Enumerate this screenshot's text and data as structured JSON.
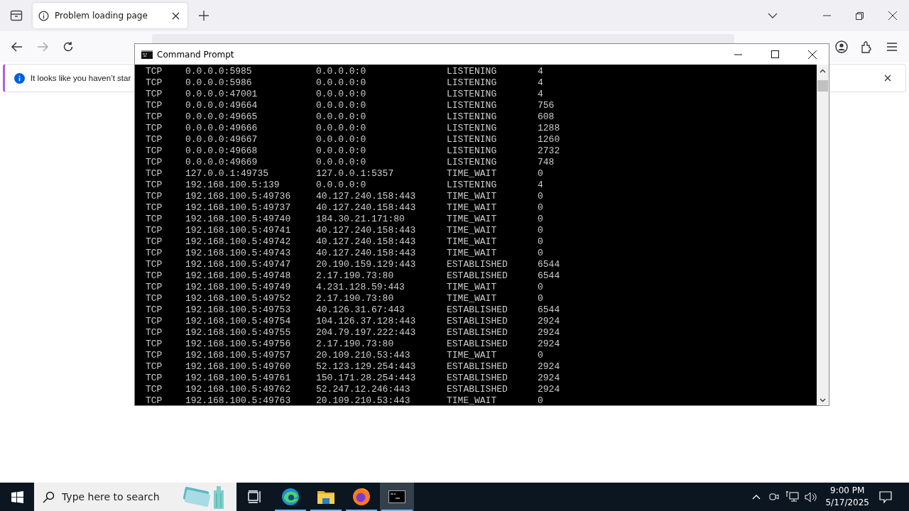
{
  "browser": {
    "tab": {
      "title": "Problem loading page"
    },
    "notification": {
      "text": "It looks like you haven’t star"
    }
  },
  "console": {
    "title": "Command Prompt",
    "rows": [
      [
        "TCP",
        "0.0.0.0:5985",
        "0.0.0.0:0",
        "LISTENING",
        "4"
      ],
      [
        "TCP",
        "0.0.0.0:5986",
        "0.0.0.0:0",
        "LISTENING",
        "4"
      ],
      [
        "TCP",
        "0.0.0.0:47001",
        "0.0.0.0:0",
        "LISTENING",
        "4"
      ],
      [
        "TCP",
        "0.0.0.0:49664",
        "0.0.0.0:0",
        "LISTENING",
        "756"
      ],
      [
        "TCP",
        "0.0.0.0:49665",
        "0.0.0.0:0",
        "LISTENING",
        "608"
      ],
      [
        "TCP",
        "0.0.0.0:49666",
        "0.0.0.0:0",
        "LISTENING",
        "1288"
      ],
      [
        "TCP",
        "0.0.0.0:49667",
        "0.0.0.0:0",
        "LISTENING",
        "1260"
      ],
      [
        "TCP",
        "0.0.0.0:49668",
        "0.0.0.0:0",
        "LISTENING",
        "2732"
      ],
      [
        "TCP",
        "0.0.0.0:49669",
        "0.0.0.0:0",
        "LISTENING",
        "748"
      ],
      [
        "TCP",
        "127.0.0.1:49735",
        "127.0.0.1:5357",
        "TIME_WAIT",
        "0"
      ],
      [
        "TCP",
        "192.168.100.5:139",
        "0.0.0.0:0",
        "LISTENING",
        "4"
      ],
      [
        "TCP",
        "192.168.100.5:49736",
        "40.127.240.158:443",
        "TIME_WAIT",
        "0"
      ],
      [
        "TCP",
        "192.168.100.5:49737",
        "40.127.240.158:443",
        "TIME_WAIT",
        "0"
      ],
      [
        "TCP",
        "192.168.100.5:49740",
        "184.30.21.171:80",
        "TIME_WAIT",
        "0"
      ],
      [
        "TCP",
        "192.168.100.5:49741",
        "40.127.240.158:443",
        "TIME_WAIT",
        "0"
      ],
      [
        "TCP",
        "192.168.100.5:49742",
        "40.127.240.158:443",
        "TIME_WAIT",
        "0"
      ],
      [
        "TCP",
        "192.168.100.5:49743",
        "40.127.240.158:443",
        "TIME_WAIT",
        "0"
      ],
      [
        "TCP",
        "192.168.100.5:49747",
        "20.190.159.129:443",
        "ESTABLISHED",
        "6544"
      ],
      [
        "TCP",
        "192.168.100.5:49748",
        "2.17.190.73:80",
        "ESTABLISHED",
        "6544"
      ],
      [
        "TCP",
        "192.168.100.5:49749",
        "4.231.128.59:443",
        "TIME_WAIT",
        "0"
      ],
      [
        "TCP",
        "192.168.100.5:49752",
        "2.17.190.73:80",
        "TIME_WAIT",
        "0"
      ],
      [
        "TCP",
        "192.168.100.5:49753",
        "40.126.31.67:443",
        "ESTABLISHED",
        "6544"
      ],
      [
        "TCP",
        "192.168.100.5:49754",
        "104.126.37.128:443",
        "ESTABLISHED",
        "2924"
      ],
      [
        "TCP",
        "192.168.100.5:49755",
        "204.79.197.222:443",
        "ESTABLISHED",
        "2924"
      ],
      [
        "TCP",
        "192.168.100.5:49756",
        "2.17.190.73:80",
        "ESTABLISHED",
        "2924"
      ],
      [
        "TCP",
        "192.168.100.5:49757",
        "20.109.210.53:443",
        "TIME_WAIT",
        "0"
      ],
      [
        "TCP",
        "192.168.100.5:49760",
        "52.123.129.254:443",
        "ESTABLISHED",
        "2924"
      ],
      [
        "TCP",
        "192.168.100.5:49761",
        "150.171.28.254:443",
        "ESTABLISHED",
        "2924"
      ],
      [
        "TCP",
        "192.168.100.5:49762",
        "52.247.12.246:443",
        "ESTABLISHED",
        "2924"
      ],
      [
        "TCP",
        "192.168.100.5:49763",
        "20.109.210.53:443",
        "TIME_WAIT",
        "0"
      ]
    ]
  },
  "taskbar": {
    "search": {
      "placeholder": "Type here to search"
    },
    "apps": [
      {
        "kind": "taskview",
        "running": false,
        "selected": false
      },
      {
        "kind": "edge",
        "running": true,
        "selected": false
      },
      {
        "kind": "explorer",
        "running": true,
        "selected": false
      },
      {
        "kind": "firefox",
        "running": true,
        "selected": false
      },
      {
        "kind": "terminal",
        "running": true,
        "selected": true
      }
    ],
    "time": "9:00 PM",
    "date": "5/17/2025"
  }
}
